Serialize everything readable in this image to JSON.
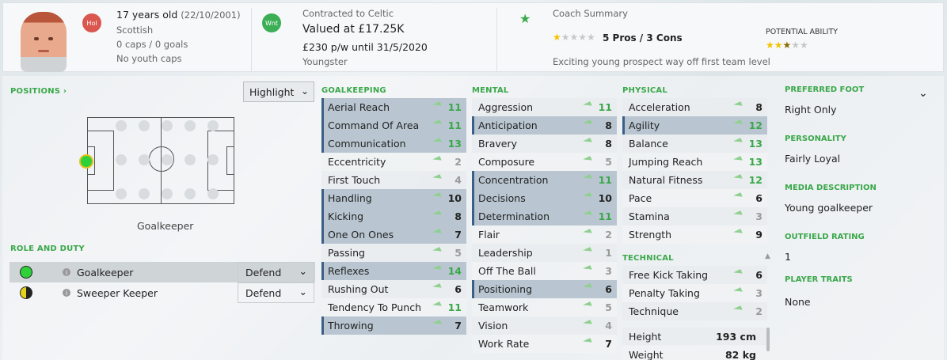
{
  "header": {
    "age": "17 years old",
    "dob": "(22/10/2001)",
    "nationality": "Scottish",
    "caps": "0 caps / 0 goals",
    "youth_caps": "No youth caps",
    "badge1": "Hol",
    "badge2": "Wnt",
    "contract": "Contracted to Celtic",
    "value": "Valued at £17.25K",
    "wage": "£230 p/w until 31/5/2020",
    "status": "Youngster",
    "coach_title": "Coach Summary",
    "pros_cons": "5 Pros / 3 Cons",
    "coach_text": "Exciting young prospect way off first team level",
    "pa_label": "POTENTIAL ABILITY",
    "current_ability_stars": 1,
    "potential_ability_stars": 2.5
  },
  "positions": {
    "title": "POSITIONS",
    "highlight_label": "Highlight",
    "position_name": "Goalkeeper",
    "role_duty_title": "ROLE AND DUTY",
    "roles": [
      {
        "name": "Goalkeeper",
        "duty": "Defend",
        "color": "#2ed13a"
      },
      {
        "name": "Sweeper Keeper",
        "duty": "Defend",
        "color": "#e4d21b"
      }
    ]
  },
  "goalkeeping": {
    "title": "GOALKEEPING",
    "rows": [
      {
        "name": "Aerial Reach",
        "value": "11"
      },
      {
        "name": "Command Of Area",
        "value": "11"
      },
      {
        "name": "Communication",
        "value": "13"
      },
      {
        "name": "Eccentricity",
        "value": "2"
      },
      {
        "name": "First Touch",
        "value": "4"
      },
      {
        "name": "Handling",
        "value": "10"
      },
      {
        "name": "Kicking",
        "value": "8"
      },
      {
        "name": "One On Ones",
        "value": "7"
      },
      {
        "name": "Passing",
        "value": "5"
      },
      {
        "name": "Reflexes",
        "value": "14"
      },
      {
        "name": "Rushing Out",
        "value": "6"
      },
      {
        "name": "Tendency To Punch",
        "value": "11"
      },
      {
        "name": "Throwing",
        "value": "7"
      }
    ]
  },
  "mental": {
    "title": "MENTAL",
    "rows": [
      {
        "name": "Aggression",
        "value": "11"
      },
      {
        "name": "Anticipation",
        "value": "8"
      },
      {
        "name": "Bravery",
        "value": "8"
      },
      {
        "name": "Composure",
        "value": "5"
      },
      {
        "name": "Concentration",
        "value": "11"
      },
      {
        "name": "Decisions",
        "value": "10"
      },
      {
        "name": "Determination",
        "value": "11"
      },
      {
        "name": "Flair",
        "value": "2"
      },
      {
        "name": "Leadership",
        "value": "1"
      },
      {
        "name": "Off The Ball",
        "value": "3"
      },
      {
        "name": "Positioning",
        "value": "6"
      },
      {
        "name": "Teamwork",
        "value": "5"
      },
      {
        "name": "Vision",
        "value": "4"
      },
      {
        "name": "Work Rate",
        "value": "7"
      }
    ]
  },
  "physical": {
    "title": "PHYSICAL",
    "rows": [
      {
        "name": "Acceleration",
        "value": "8"
      },
      {
        "name": "Agility",
        "value": "12"
      },
      {
        "name": "Balance",
        "value": "13"
      },
      {
        "name": "Jumping Reach",
        "value": "13"
      },
      {
        "name": "Natural Fitness",
        "value": "12"
      },
      {
        "name": "Pace",
        "value": "6"
      },
      {
        "name": "Stamina",
        "value": "3"
      },
      {
        "name": "Strength",
        "value": "9"
      }
    ]
  },
  "technical": {
    "title": "TECHNICAL",
    "rows": [
      {
        "name": "Free Kick Taking",
        "value": "6"
      },
      {
        "name": "Penalty Taking",
        "value": "3"
      },
      {
        "name": "Technique",
        "value": "2"
      }
    ]
  },
  "body": {
    "height_label": "Height",
    "height": "193 cm",
    "weight_label": "Weight",
    "weight": "82 kg"
  },
  "info": {
    "foot_label": "PREFERRED FOOT",
    "foot": "Right Only",
    "personality_label": "PERSONALITY",
    "personality": "Fairly Loyal",
    "media_label": "MEDIA DESCRIPTION",
    "media": "Young goalkeeper",
    "outfield_label": "OUTFIELD RATING",
    "outfield": "1",
    "traits_label": "PLAYER TRAITS",
    "traits": "None"
  },
  "colors": {
    "accent_green": "#3aa84a",
    "key_attr": "#b9c6d1"
  }
}
